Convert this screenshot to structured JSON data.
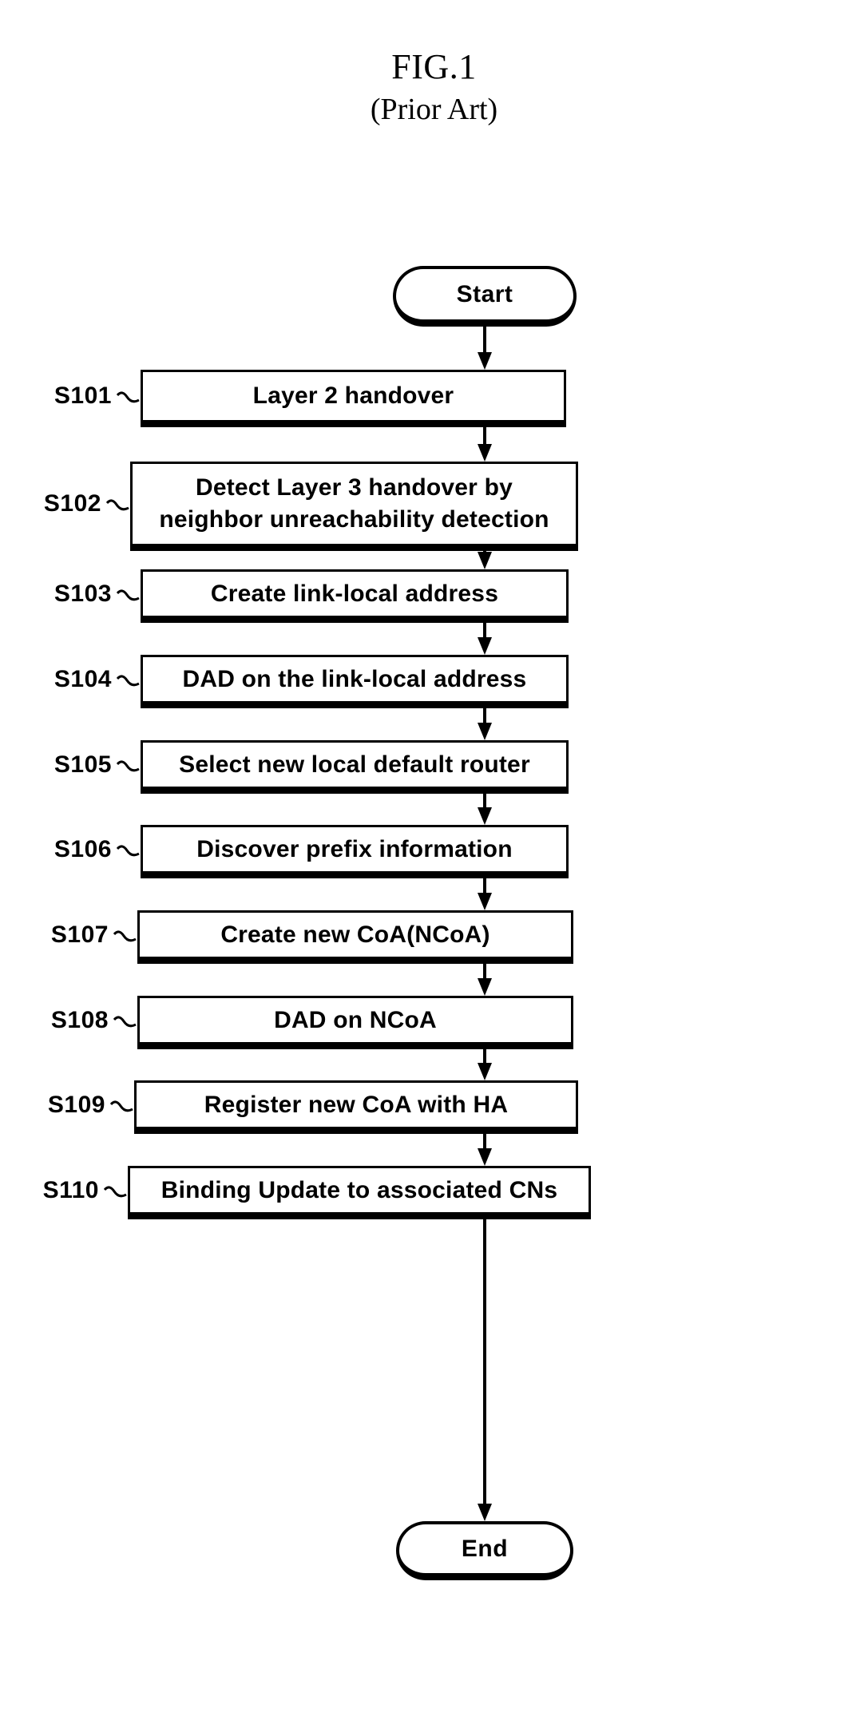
{
  "figure": {
    "title": "FIG.1",
    "subtitle": "(Prior Art)"
  },
  "colors": {
    "stroke": "#000000",
    "background": "#ffffff"
  },
  "flowchart": {
    "type": "flowchart",
    "orientation": "vertical",
    "start": {
      "label": "Start"
    },
    "end": {
      "label": "End"
    },
    "steps": [
      {
        "id": "S101",
        "text": "Layer 2 handover"
      },
      {
        "id": "S102",
        "text": "Detect Layer 3 handover by\nneighbor unreachability detection"
      },
      {
        "id": "S103",
        "text": "Create link-local address"
      },
      {
        "id": "S104",
        "text": "DAD on the link-local address"
      },
      {
        "id": "S105",
        "text": "Select new local default router"
      },
      {
        "id": "S106",
        "text": "Discover prefix information"
      },
      {
        "id": "S107",
        "text": "Create new CoA(NCoA)"
      },
      {
        "id": "S108",
        "text": "DAD on NCoA"
      },
      {
        "id": "S109",
        "text": "Register new CoA with HA"
      },
      {
        "id": "S110",
        "text": "Binding Update to associated CNs"
      }
    ]
  }
}
